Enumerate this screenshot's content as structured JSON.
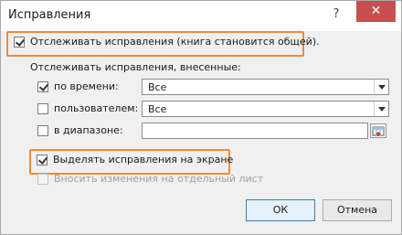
{
  "window": {
    "title": "Исправления",
    "help_glyph": "?",
    "close_glyph": "✕"
  },
  "options": {
    "track_changes": {
      "label": "Отслеживать исправления (книга становится общей).",
      "checked": true
    },
    "section_label": "Отслеживать исправления, внесенные:",
    "by_time": {
      "label": "по времени:",
      "checked": true,
      "value": "Все"
    },
    "by_user": {
      "label": "пользователем:",
      "checked": false,
      "value": "Все"
    },
    "in_range": {
      "label": "в диапазоне:",
      "checked": false,
      "value": ""
    },
    "highlight_on_screen": {
      "label": "Выделять исправления на экране",
      "checked": true
    },
    "list_on_sheet": {
      "label": "Вносить изменения на отдельный лист",
      "checked": false,
      "disabled": true
    }
  },
  "buttons": {
    "ok": "ОК",
    "cancel": "Отмена"
  },
  "colors": {
    "highlight": "#ee8a3b",
    "close": "#c74f50"
  }
}
